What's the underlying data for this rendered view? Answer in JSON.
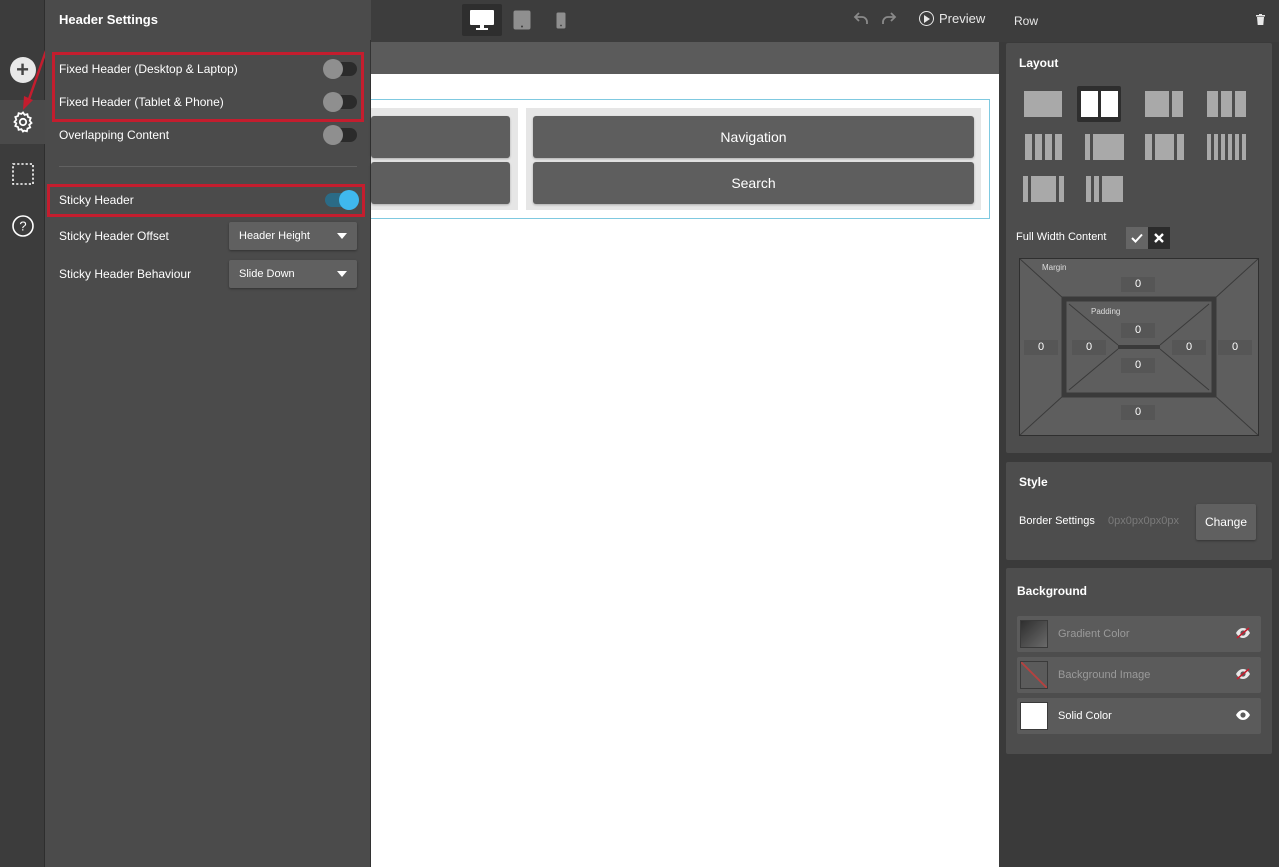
{
  "settings": {
    "title": "Header Settings",
    "fixed_desktop": {
      "label": "Fixed Header (Desktop & Laptop)",
      "on": false
    },
    "fixed_tablet": {
      "label": "Fixed Header (Tablet & Phone)",
      "on": false
    },
    "overlap": {
      "label": "Overlapping Content",
      "on": false
    },
    "sticky": {
      "label": "Sticky Header",
      "on": true
    },
    "offset": {
      "label": "Sticky Header Offset",
      "value": "Header Height"
    },
    "behaviour": {
      "label": "Sticky Header Behaviour",
      "value": "Slide Down"
    }
  },
  "toolbar": {
    "preview_label": "Preview",
    "devices": [
      "desktop-icon",
      "tablet-icon",
      "phone-icon"
    ]
  },
  "canvas": {
    "navigation_label": "Navigation",
    "search_label": "Search"
  },
  "right_panel": {
    "title": "Row",
    "layout": {
      "title": "Layout",
      "full_width_label": "Full Width Content"
    },
    "box_model": {
      "margin_label": "Margin",
      "padding_label": "Padding",
      "margin": {
        "top": "0",
        "right": "0",
        "bottom": "0",
        "left": "0"
      },
      "padding": {
        "top": "0",
        "right": "0",
        "bottom": "0",
        "left": "0"
      }
    },
    "style": {
      "title": "Style",
      "border_label": "Border Settings",
      "border_value": "0px0px0px0px",
      "change_label": "Change"
    },
    "background": {
      "title": "Background",
      "items": [
        {
          "label": "Gradient Color"
        },
        {
          "label": "Background Image"
        },
        {
          "label": "Solid Color"
        }
      ]
    }
  },
  "colors": {
    "accent": "#3fb8ee",
    "highlight": "#c41d2e",
    "panel": "#4b4b4b"
  }
}
